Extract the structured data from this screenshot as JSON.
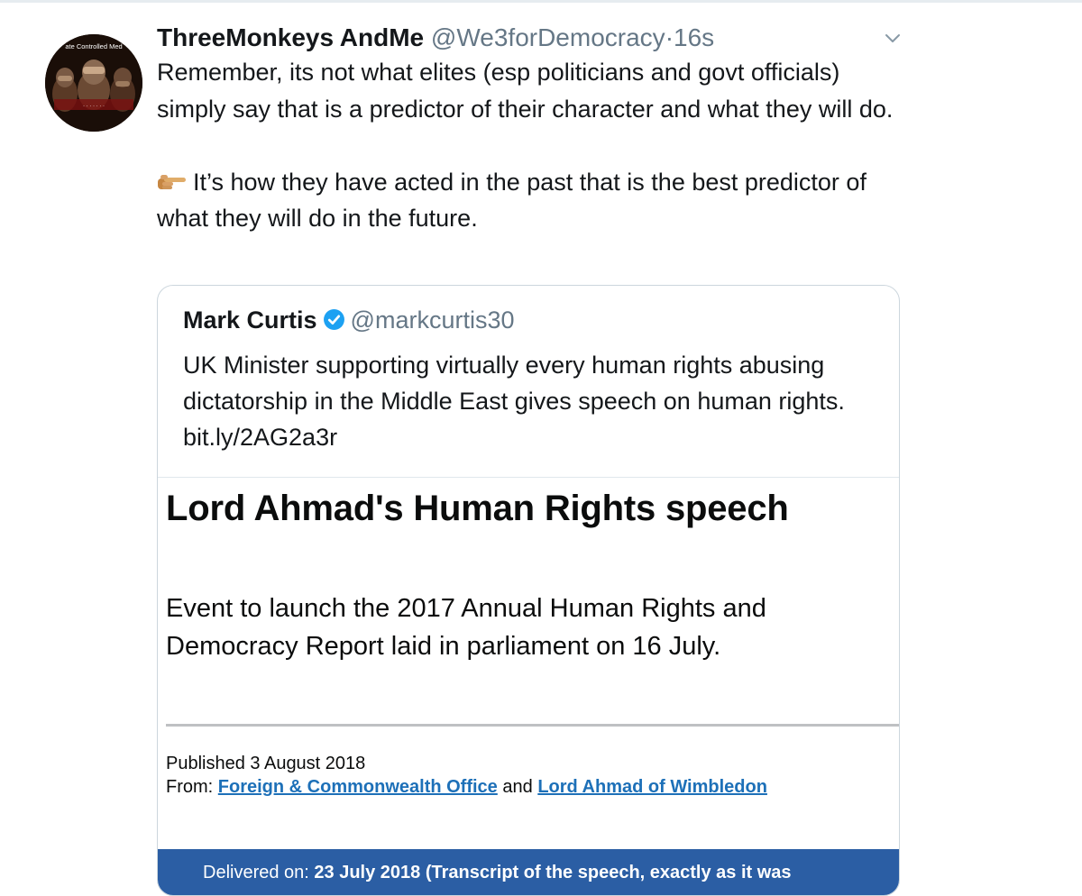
{
  "tweet": {
    "author_name": "ThreeMonkeys AndMe",
    "author_handle": "@We3forDemocracy",
    "separator": "·",
    "timestamp": "16s",
    "avatar_caption": "ate Controlled Med",
    "paragraph1": "Remember, its not what elites (esp politicians and govt officials) simply say that is a predictor of their character and what they will do.",
    "paragraph2": "It’s how they have acted in the past that is the best predictor of what they will do in the future.",
    "menu_icon": "chevron-down-icon",
    "pointer_emoji_icon": "backhand-index-pointing-right-icon"
  },
  "quote": {
    "author_name": "Mark Curtis",
    "author_handle": "@markcurtis30",
    "verified_icon": "verified-badge-icon",
    "text": "UK Minister supporting virtually every human rights abusing dictatorship in the Middle East gives speech on human rights. bit.ly/2AG2a3r"
  },
  "preview": {
    "title": "Lord Ahmad's Human Rights speech",
    "summary": "Event to launch the 2017 Annual Human Rights and Democracy Report laid in parliament on 16 July.",
    "published": "Published 3 August 2018",
    "from_label": "From:",
    "org_link": "Foreign & Commonwealth Office",
    "and_word": "and",
    "person_link": "Lord Ahmad of Wimbledon",
    "delivered_label": "Delivered on:",
    "delivered_value": "23 July 2018 (Transcript of the speech, exactly as it was"
  },
  "colors": {
    "text": "#14171a",
    "secondary": "#657786",
    "verified": "#1da1f2",
    "gov_link": "#1d70b8",
    "banner": "#2b5ea4"
  }
}
